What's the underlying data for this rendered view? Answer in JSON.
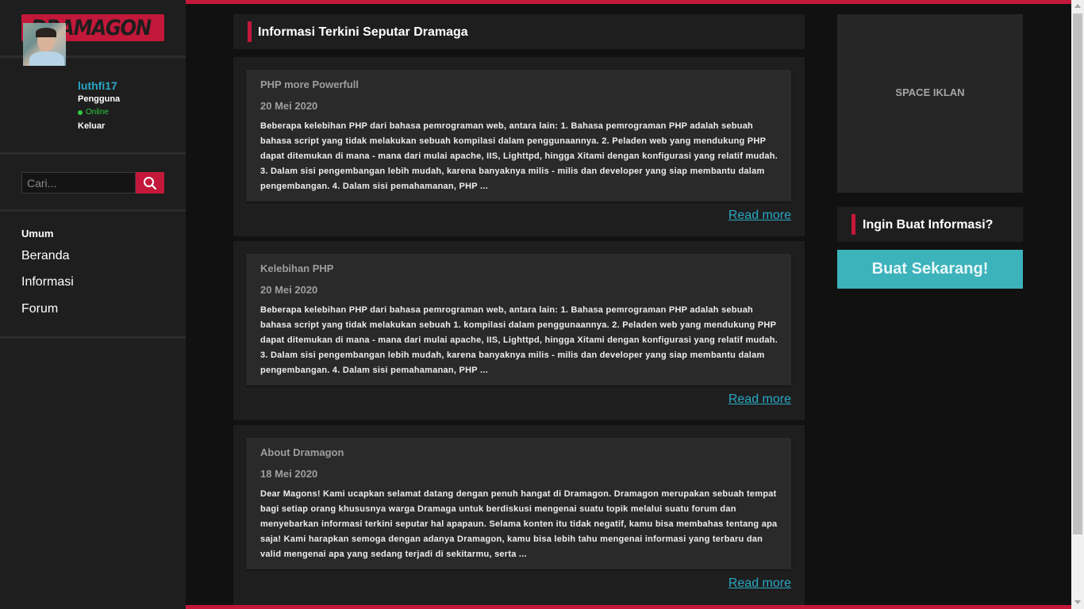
{
  "brand": {
    "logo_text": "DRAMAGON",
    "accent_color": "#c3183a",
    "link_color": "#2aa8c5",
    "cta_color": "#3cb2bb"
  },
  "user": {
    "name": "luthfi17",
    "role": "Pengguna",
    "status": "Online",
    "logout_label": "Keluar"
  },
  "search": {
    "placeholder": "Cari...",
    "button_icon": "search-icon"
  },
  "nav": {
    "heading": "Umum",
    "items": [
      {
        "label": "Beranda"
      },
      {
        "label": "Informasi"
      },
      {
        "label": "Forum"
      }
    ]
  },
  "main": {
    "title": "Informasi Terkini Seputar Dramaga",
    "read_more_label": "Read more",
    "posts": [
      {
        "title": "PHP more Powerfull",
        "date": "20 Mei 2020",
        "excerpt": "Beberapa kelebihan PHP dari bahasa pemrograman web, antara lain: 1. Bahasa pemrograman PHP adalah sebuah bahasa script yang tidak melakukan sebuah kompilasi dalam penggunaannya. 2. Peladen web yang mendukung PHP dapat ditemukan di mana - mana dari mulai apache, IIS, Lighttpd, hingga Xitami dengan konfigurasi yang relatif mudah. 3. Dalam sisi pengembangan lebih mudah, karena banyaknya milis - milis dan developer yang siap membantu dalam pengembangan. 4. Dalam sisi pemahamanan, PHP ..."
      },
      {
        "title": "Kelebihan PHP",
        "date": "20 Mei 2020",
        "excerpt": "Beberapa kelebihan PHP dari bahasa pemrograman web, antara lain: 1. Bahasa pemrograman PHP adalah sebuah bahasa script yang tidak melakukan sebuah 1. kompilasi dalam penggunaannya. 2. Peladen web yang mendukung PHP dapat ditemukan di mana - mana dari mulai apache, IIS, Lighttpd, hingga Xitami dengan konfigurasi yang relatif mudah. 3. Dalam sisi pengembangan lebih mudah, karena banyaknya milis - milis dan developer yang siap membantu dalam pengembangan. 4. Dalam sisi pemahamanan, PHP ..."
      },
      {
        "title": "About Dramagon",
        "date": "18 Mei 2020",
        "excerpt": "Dear Magons! Kami ucapkan selamat datang dengan penuh hangat di Dramagon. Dramagon merupakan sebuah tempat bagi setiap orang khususnya warga Dramaga untuk berdiskusi mengenai suatu topik melalui suatu forum dan menyebarkan informasi terkini seputar hal apapaun. Selama konten itu tidak negatif, kamu bisa membahas tentang apa saja! Kami harapkan semoga dengan adanya Dramagon, kamu bisa lebih tahu mengenai informasi yang terbaru dan valid mengenai apa yang sedang terjadi di sekitarmu, serta ..."
      }
    ]
  },
  "aside": {
    "ad_label": "SPACE IKLAN",
    "cta_title": "Ingin Buat Informasi?",
    "cta_button": "Buat Sekarang!"
  }
}
